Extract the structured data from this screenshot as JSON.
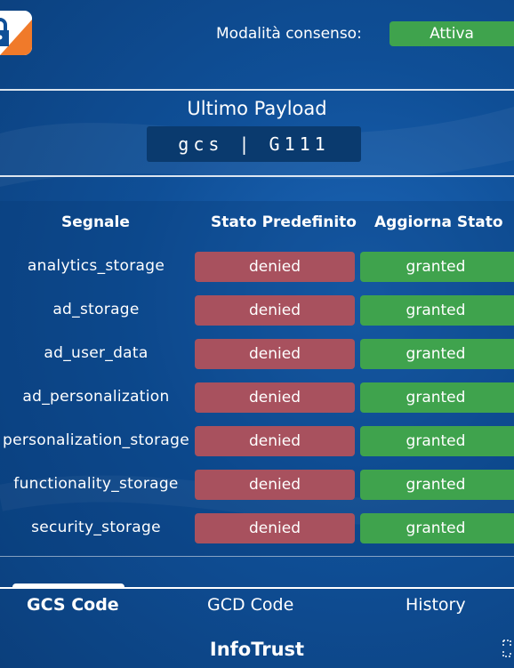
{
  "header": {
    "consent_label": "Modalità consenso:",
    "consent_status": "Attiva",
    "logo_icon": "lock-shield-icon"
  },
  "payload": {
    "title": "Ultimo Payload",
    "value": "gcs | G111"
  },
  "table": {
    "headers": {
      "signal": "Segnale",
      "default": "Stato Predefinito",
      "update": "Aggiorna Stato"
    },
    "rows": [
      {
        "signal": "analytics_storage",
        "default": "denied",
        "update": "granted"
      },
      {
        "signal": "ad_storage",
        "default": "denied",
        "update": "granted"
      },
      {
        "signal": "ad_user_data",
        "default": "denied",
        "update": "granted"
      },
      {
        "signal": "ad_personalization",
        "default": "denied",
        "update": "granted"
      },
      {
        "signal": "personalization_storage",
        "default": "denied",
        "update": "granted"
      },
      {
        "signal": "functionality_storage",
        "default": "denied",
        "update": "granted"
      },
      {
        "signal": "security_storage",
        "default": "denied",
        "update": "granted"
      }
    ]
  },
  "tabs": [
    {
      "label": "GCS Code",
      "active": true
    },
    {
      "label": "GCD Code",
      "active": false
    },
    {
      "label": "History",
      "active": false
    }
  ],
  "footer": {
    "brand": "InfoTrust"
  },
  "colors": {
    "granted": "#3fa34d",
    "denied": "#a8515e",
    "background": "#0f4f97"
  }
}
